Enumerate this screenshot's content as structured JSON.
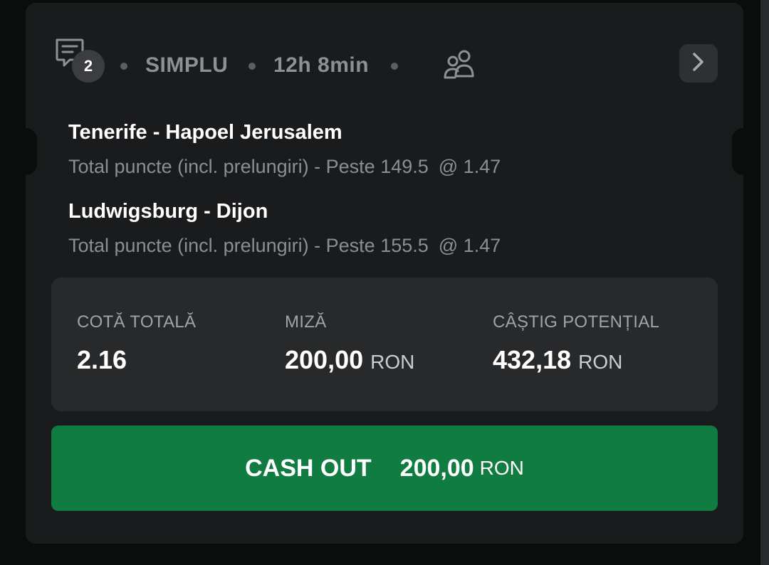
{
  "header": {
    "comments_count": "2",
    "bet_type": "SIMPLU",
    "time_remaining": "12h 8min"
  },
  "bets": [
    {
      "match": "Tenerife - Hapoel Jerusalem",
      "market": "Total puncte (incl. prelungiri) - Peste 149.5",
      "odds": "@ 1.47"
    },
    {
      "match": "Ludwigsburg - Dijon",
      "market": "Total puncte (incl. prelungiri) - Peste 155.5",
      "odds": "@ 1.47"
    }
  ],
  "summary": {
    "total_odds_label": "COTĂ TOTALĂ",
    "total_odds_value": "2.16",
    "stake_label": "MIZĂ",
    "stake_value": "200,00",
    "stake_currency": "RON",
    "potential_win_label": "CÂȘTIG POTENȚIAL",
    "potential_win_value": "432,18",
    "potential_win_currency": "RON"
  },
  "cashout": {
    "label": "CASH OUT",
    "amount": "200,00",
    "currency": "RON"
  },
  "icons": {
    "comment": "comment-icon",
    "users": "users-icon",
    "next": "chevron-right-icon"
  },
  "colors": {
    "background": "#0b0c0c",
    "card": "#1a1b1c",
    "summary_panel": "#28292b",
    "cashout_green": "#107c41",
    "muted_text": "#8d9196"
  }
}
